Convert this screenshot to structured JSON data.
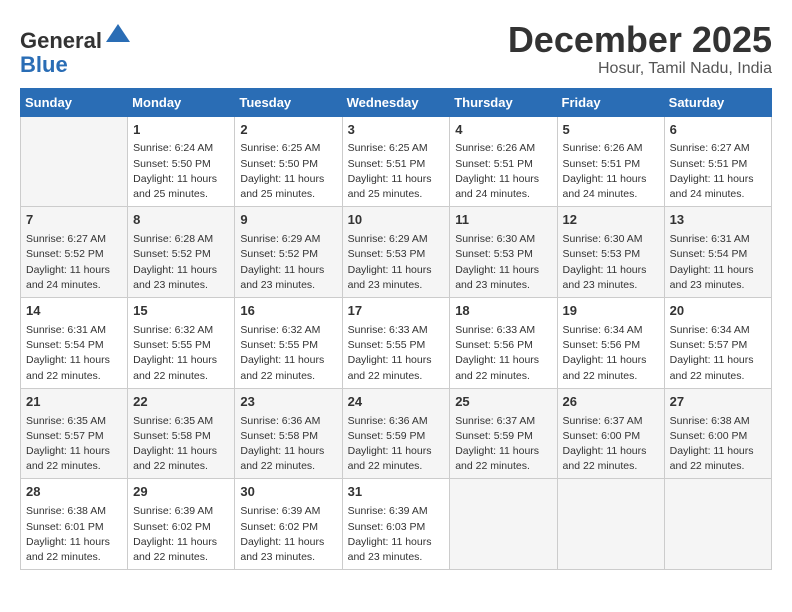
{
  "header": {
    "logo_line1": "General",
    "logo_line2": "Blue",
    "month": "December 2025",
    "location": "Hosur, Tamil Nadu, India"
  },
  "weekdays": [
    "Sunday",
    "Monday",
    "Tuesday",
    "Wednesday",
    "Thursday",
    "Friday",
    "Saturday"
  ],
  "weeks": [
    [
      {
        "day": "",
        "info": ""
      },
      {
        "day": "1",
        "info": "Sunrise: 6:24 AM\nSunset: 5:50 PM\nDaylight: 11 hours\nand 25 minutes."
      },
      {
        "day": "2",
        "info": "Sunrise: 6:25 AM\nSunset: 5:50 PM\nDaylight: 11 hours\nand 25 minutes."
      },
      {
        "day": "3",
        "info": "Sunrise: 6:25 AM\nSunset: 5:51 PM\nDaylight: 11 hours\nand 25 minutes."
      },
      {
        "day": "4",
        "info": "Sunrise: 6:26 AM\nSunset: 5:51 PM\nDaylight: 11 hours\nand 24 minutes."
      },
      {
        "day": "5",
        "info": "Sunrise: 6:26 AM\nSunset: 5:51 PM\nDaylight: 11 hours\nand 24 minutes."
      },
      {
        "day": "6",
        "info": "Sunrise: 6:27 AM\nSunset: 5:51 PM\nDaylight: 11 hours\nand 24 minutes."
      }
    ],
    [
      {
        "day": "7",
        "info": "Sunrise: 6:27 AM\nSunset: 5:52 PM\nDaylight: 11 hours\nand 24 minutes."
      },
      {
        "day": "8",
        "info": "Sunrise: 6:28 AM\nSunset: 5:52 PM\nDaylight: 11 hours\nand 23 minutes."
      },
      {
        "day": "9",
        "info": "Sunrise: 6:29 AM\nSunset: 5:52 PM\nDaylight: 11 hours\nand 23 minutes."
      },
      {
        "day": "10",
        "info": "Sunrise: 6:29 AM\nSunset: 5:53 PM\nDaylight: 11 hours\nand 23 minutes."
      },
      {
        "day": "11",
        "info": "Sunrise: 6:30 AM\nSunset: 5:53 PM\nDaylight: 11 hours\nand 23 minutes."
      },
      {
        "day": "12",
        "info": "Sunrise: 6:30 AM\nSunset: 5:53 PM\nDaylight: 11 hours\nand 23 minutes."
      },
      {
        "day": "13",
        "info": "Sunrise: 6:31 AM\nSunset: 5:54 PM\nDaylight: 11 hours\nand 23 minutes."
      }
    ],
    [
      {
        "day": "14",
        "info": "Sunrise: 6:31 AM\nSunset: 5:54 PM\nDaylight: 11 hours\nand 22 minutes."
      },
      {
        "day": "15",
        "info": "Sunrise: 6:32 AM\nSunset: 5:55 PM\nDaylight: 11 hours\nand 22 minutes."
      },
      {
        "day": "16",
        "info": "Sunrise: 6:32 AM\nSunset: 5:55 PM\nDaylight: 11 hours\nand 22 minutes."
      },
      {
        "day": "17",
        "info": "Sunrise: 6:33 AM\nSunset: 5:55 PM\nDaylight: 11 hours\nand 22 minutes."
      },
      {
        "day": "18",
        "info": "Sunrise: 6:33 AM\nSunset: 5:56 PM\nDaylight: 11 hours\nand 22 minutes."
      },
      {
        "day": "19",
        "info": "Sunrise: 6:34 AM\nSunset: 5:56 PM\nDaylight: 11 hours\nand 22 minutes."
      },
      {
        "day": "20",
        "info": "Sunrise: 6:34 AM\nSunset: 5:57 PM\nDaylight: 11 hours\nand 22 minutes."
      }
    ],
    [
      {
        "day": "21",
        "info": "Sunrise: 6:35 AM\nSunset: 5:57 PM\nDaylight: 11 hours\nand 22 minutes."
      },
      {
        "day": "22",
        "info": "Sunrise: 6:35 AM\nSunset: 5:58 PM\nDaylight: 11 hours\nand 22 minutes."
      },
      {
        "day": "23",
        "info": "Sunrise: 6:36 AM\nSunset: 5:58 PM\nDaylight: 11 hours\nand 22 minutes."
      },
      {
        "day": "24",
        "info": "Sunrise: 6:36 AM\nSunset: 5:59 PM\nDaylight: 11 hours\nand 22 minutes."
      },
      {
        "day": "25",
        "info": "Sunrise: 6:37 AM\nSunset: 5:59 PM\nDaylight: 11 hours\nand 22 minutes."
      },
      {
        "day": "26",
        "info": "Sunrise: 6:37 AM\nSunset: 6:00 PM\nDaylight: 11 hours\nand 22 minutes."
      },
      {
        "day": "27",
        "info": "Sunrise: 6:38 AM\nSunset: 6:00 PM\nDaylight: 11 hours\nand 22 minutes."
      }
    ],
    [
      {
        "day": "28",
        "info": "Sunrise: 6:38 AM\nSunset: 6:01 PM\nDaylight: 11 hours\nand 22 minutes."
      },
      {
        "day": "29",
        "info": "Sunrise: 6:39 AM\nSunset: 6:02 PM\nDaylight: 11 hours\nand 22 minutes."
      },
      {
        "day": "30",
        "info": "Sunrise: 6:39 AM\nSunset: 6:02 PM\nDaylight: 11 hours\nand 23 minutes."
      },
      {
        "day": "31",
        "info": "Sunrise: 6:39 AM\nSunset: 6:03 PM\nDaylight: 11 hours\nand 23 minutes."
      },
      {
        "day": "",
        "info": ""
      },
      {
        "day": "",
        "info": ""
      },
      {
        "day": "",
        "info": ""
      }
    ]
  ]
}
